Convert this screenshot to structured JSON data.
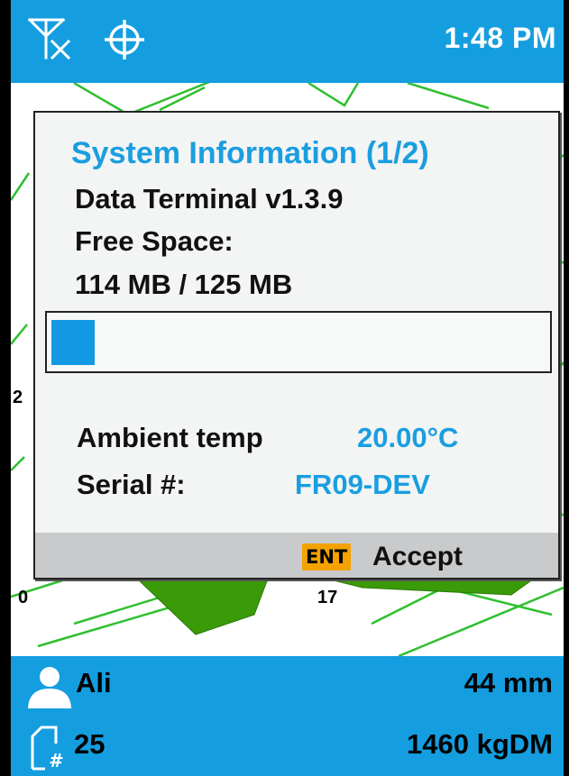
{
  "status_bar": {
    "time": "1:48 PM",
    "icons": [
      "antenna-no-signal-icon",
      "crosshair-icon"
    ]
  },
  "map": {
    "labels": [
      "0",
      "17",
      "2"
    ]
  },
  "dialog": {
    "title": "System Information (1/2)",
    "app_version": "Data Terminal v1.3.9",
    "free_space_label": "Free Space:",
    "free_space_value": "114 MB / 125 MB",
    "progress_fraction": 0.088,
    "ambient_temp_label": "Ambient temp",
    "ambient_temp_value": "20.00°C",
    "serial_label": "Serial #:",
    "serial_value": "FR09-DEV",
    "footer": {
      "key_label": "ENT",
      "action_label": "Accept"
    }
  },
  "bottom_bar": {
    "user_name": "Ali",
    "depth": "44 mm",
    "doc_count": "25",
    "yield": "1460 kgDM"
  },
  "colors": {
    "accent": "#149ee0",
    "accent_text": "#1a9ee0",
    "field_fill": "#3a9a08",
    "key_badge": "#f3a200"
  }
}
